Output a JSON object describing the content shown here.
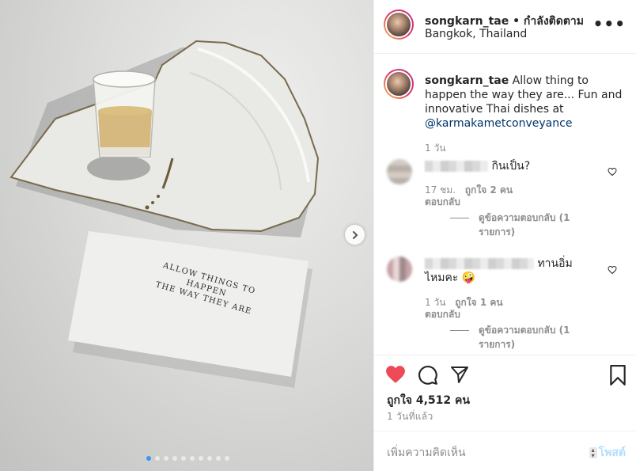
{
  "header": {
    "username": "songkarn_tae",
    "separator": "•",
    "follow_label": "กำลังติดตาม",
    "location": "Bangkok, Thailand",
    "more_label": "•••"
  },
  "photo": {
    "card_line_1": "ALLOW THINGS TO HAPPEN",
    "card_line_2": "THE WAY THEY ARE",
    "slide_count": 10,
    "active_slide": 1
  },
  "caption": {
    "username": "songkarn_tae",
    "text": "Allow thing to happen the way they are... Fun and innovative Thai dishes at",
    "mention": "@karmakametconveyance",
    "time": "1 วัน"
  },
  "comments": [
    {
      "text": "กินเป็น?",
      "time": "17 ชม.",
      "likes": "ถูกใจ 2 คน",
      "reply": "ตอบกลับ",
      "view_replies": "ดูข้อความตอบกลับ (1 รายการ)"
    },
    {
      "text_a": "ทานอิ่ม",
      "text_b": "ไหมคะ",
      "emoji": "🤪",
      "time": "1 วัน",
      "likes": "ถูกใจ 1 คน",
      "reply": "ตอบกลับ",
      "view_replies": "ดูข้อความตอบกลับ (1 รายการ)"
    }
  ],
  "actions": {
    "likes": "ถูกใจ 4,512 คน",
    "posted": "1 วันที่แล้ว"
  },
  "add_comment": {
    "placeholder": "เพิ่มความคิดเห็น",
    "post_label": "โพสต์"
  },
  "colors": {
    "like_red": "#ed4956",
    "link_blue": "#003569",
    "active_dot": "#3897f0",
    "post_disabled": "#b2dffc"
  }
}
